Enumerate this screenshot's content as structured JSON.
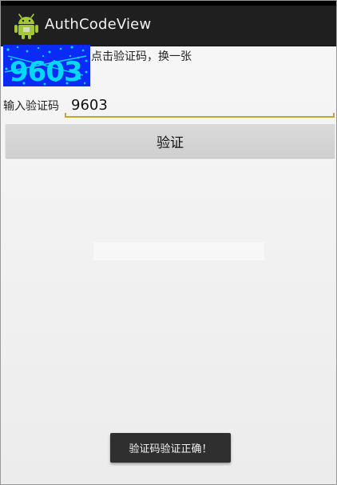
{
  "action_bar": {
    "title": "AuthCodeView",
    "icon": "android-icon"
  },
  "captcha": {
    "code": "9603",
    "hint": "点击验证码，换一张",
    "colors": {
      "background": "#0a2bf5",
      "text": "#00d8f8"
    }
  },
  "form": {
    "label": "输入验证码",
    "input_value": "9603",
    "button_label": "验证"
  },
  "toast": {
    "message": "验证码验证正确！"
  },
  "colors": {
    "action_bar": "#1f1f1f",
    "input_underline": "#c4a53a",
    "button": "#d4d4d4"
  }
}
